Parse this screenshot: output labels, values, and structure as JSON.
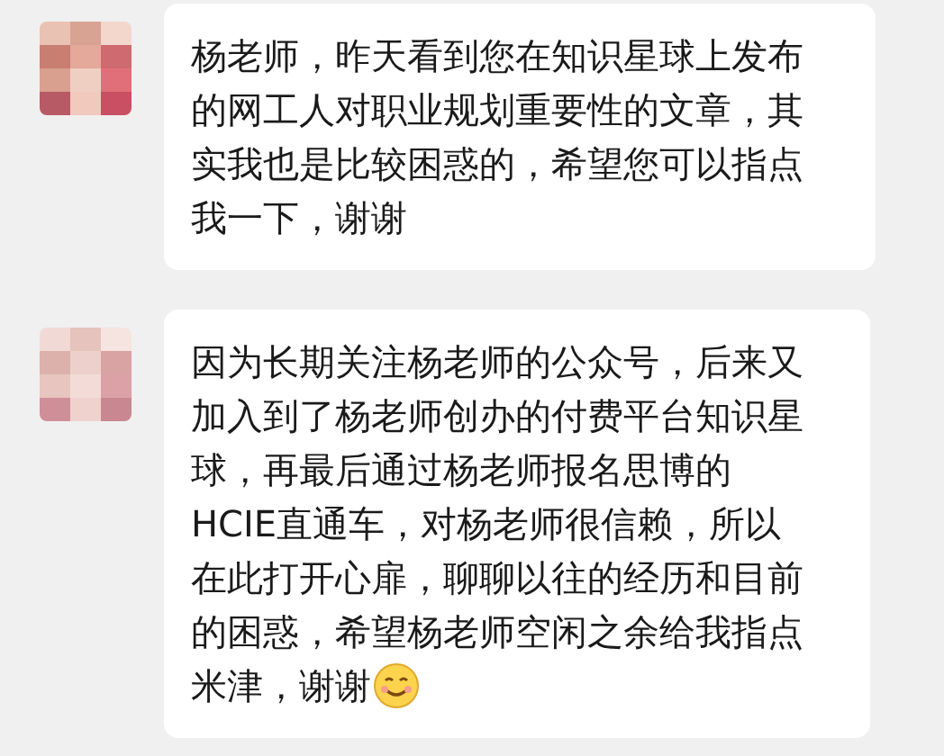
{
  "messages": [
    {
      "text": "杨老师，昨天看到您在知识星球上发布的网工人对职业规划重要性的文章，其实我也是比较困惑的，希望您可以指点我一下，谢谢",
      "emoji": false
    },
    {
      "text": "因为长期关注杨老师的公众号，后来又加入到了杨老师创办的付费平台知识星球，再最后通过杨老师报名思博的HCIE直通车，对杨老师很信赖，所以在此打开心扉，聊聊以往的经历和目前的困惑，希望杨老师空闲之余给我指点米津，谢谢",
      "emoji": true
    }
  ]
}
